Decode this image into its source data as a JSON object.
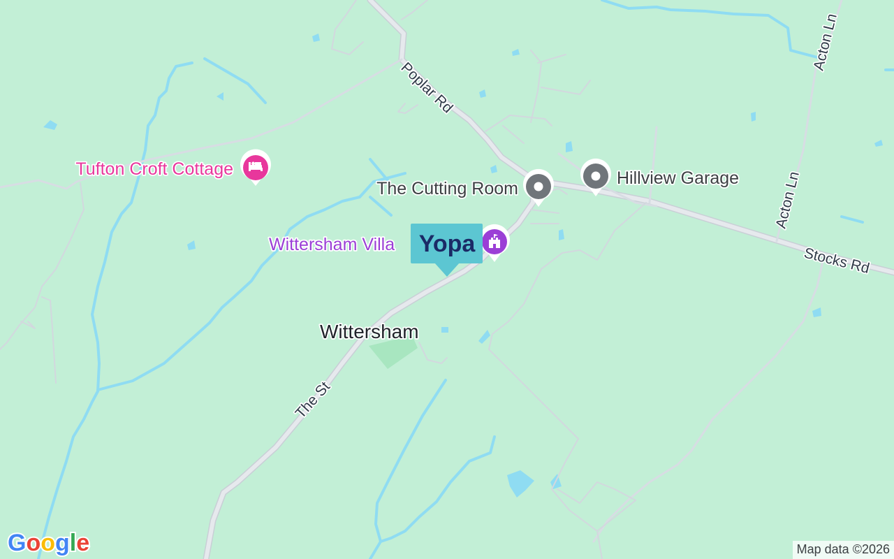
{
  "map": {
    "place_label": "Wittersham",
    "road_labels": {
      "poplar_rd": "Poplar Rd",
      "stocks_rd": "Stocks Rd",
      "the_st": "The St",
      "acton_ln_north": "Acton Ln",
      "acton_ln_south": "Acton Ln"
    },
    "pois": [
      {
        "name": "Tufton Croft Cottage",
        "icon": "bed-icon",
        "color": "#e8379c"
      },
      {
        "name": "The Cutting Room",
        "icon": "pin-icon",
        "color": "#70757a"
      },
      {
        "name": "Hillview Garage",
        "icon": "pin-icon",
        "color": "#70757a"
      },
      {
        "name": "Wittersham Villa",
        "icon": "castle-icon",
        "color": "#9b3fd6"
      }
    ],
    "marker": {
      "label": "Yopa",
      "color": "#5cc6d2",
      "text_color": "#1b2a66"
    },
    "colors": {
      "land": "#c2efd6",
      "water": "#8fdcf2",
      "road": "#dfe3e8",
      "park": "#a8e6c0"
    }
  },
  "brand": {
    "logo": "Google"
  },
  "attribution": "Map data ©2026"
}
